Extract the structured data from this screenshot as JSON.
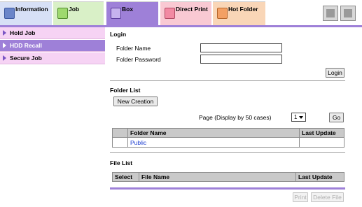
{
  "tabs": [
    {
      "id": "information",
      "label": "Information",
      "icon": "information-icon"
    },
    {
      "id": "job",
      "label": "Job",
      "icon": "job-icon"
    },
    {
      "id": "box",
      "label": "Box",
      "icon": "box-icon",
      "active": true
    },
    {
      "id": "direct",
      "label": "Direct Print",
      "icon": "direct-print-icon"
    },
    {
      "id": "hot",
      "label": "Hot Folder",
      "icon": "hot-folder-icon"
    }
  ],
  "sidebar": {
    "items": [
      {
        "label": "Hold Job"
      },
      {
        "label": "HDD Recall",
        "active": true
      },
      {
        "label": "Secure Job"
      }
    ]
  },
  "login": {
    "title": "Login",
    "folder_name_label": "Folder Name",
    "folder_name_value": "",
    "folder_password_label": "Folder Password",
    "folder_password_value": "",
    "button": "Login"
  },
  "folder_list": {
    "title": "Folder List",
    "new_button": "New Creation",
    "page_label": "Page (Display by 50 cases)",
    "page_value": "1",
    "go_button": "Go",
    "columns": [
      "",
      "Folder Name",
      "Last Update"
    ],
    "rows": [
      {
        "name": "Public",
        "last_update": ""
      }
    ]
  },
  "file_list": {
    "title": "File List",
    "columns": [
      "Select",
      "File Name",
      "Last Update"
    ]
  },
  "footer": {
    "print_button": "Print",
    "delete_button": "Delete File"
  },
  "colors": {
    "accent": "#9e80d8",
    "sidebar_bg": "#f6d3f4",
    "link": "#1a3bd0"
  }
}
